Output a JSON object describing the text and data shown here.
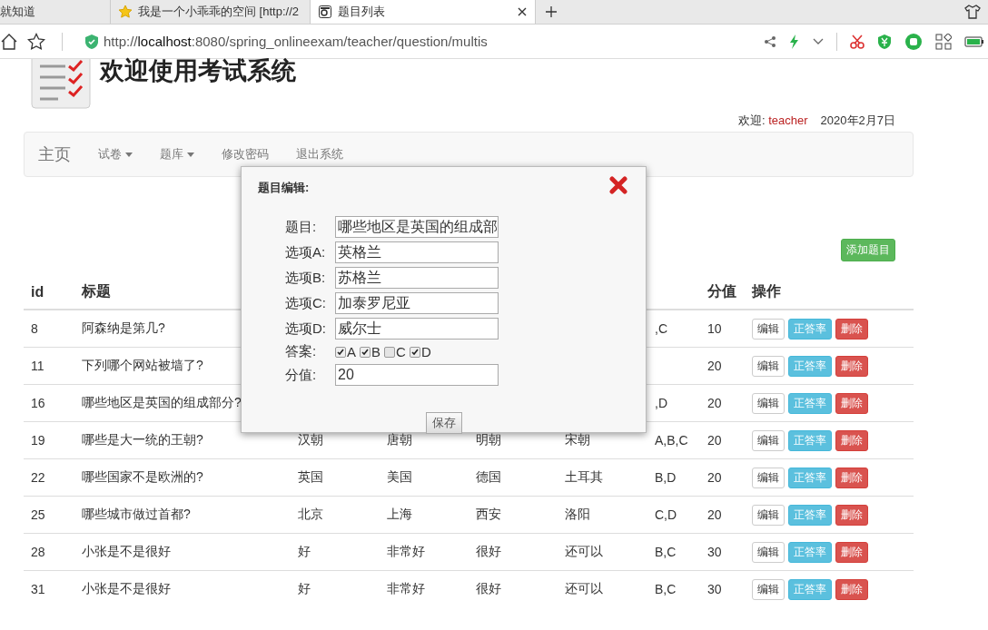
{
  "browser": {
    "tabs": [
      {
        "label": "就知道",
        "selected": false
      },
      {
        "label": "我是一个小乖乖的空间 [http://2",
        "selected": false
      },
      {
        "label": "题目列表",
        "selected": true
      }
    ],
    "address": {
      "scheme": "http://",
      "host": "localhost",
      "rest": ":8080/spring_onlineexam/teacher/question/multis"
    }
  },
  "header": {
    "title": "欢迎使用考试系统",
    "welcome_label": "欢迎:",
    "user": "teacher",
    "date": "2020年2月7日"
  },
  "nav": {
    "brand": "主页",
    "items": [
      {
        "label": "试卷",
        "dropdown": true
      },
      {
        "label": "题库",
        "dropdown": true
      },
      {
        "label": "修改密码",
        "dropdown": false
      },
      {
        "label": "退出系统",
        "dropdown": false
      }
    ]
  },
  "add_button": "添加题目",
  "table": {
    "columns": [
      {
        "label": "id"
      },
      {
        "label": "标题"
      },
      {},
      {},
      {},
      {},
      {},
      {
        "label": "分值"
      },
      {
        "label": "操作"
      }
    ],
    "rows": [
      {
        "id": "8",
        "title": "阿森纳是第几?",
        "answer": ",C",
        "score": "10"
      },
      {
        "id": "11",
        "title": "下列哪个网站被墙了?",
        "score": "20"
      },
      {
        "id": "16",
        "title": "哪些地区是英国的组成部分?",
        "answer": ",D",
        "score": "20"
      },
      {
        "id": "19",
        "title": "哪些是大一统的王朝?",
        "option_a": "汉朝",
        "option_b": "唐朝",
        "option_c": "明朝",
        "option_d": "宋朝",
        "answer": "A,B,C",
        "score": "20"
      },
      {
        "id": "22",
        "title": "哪些国家不是欧洲的?",
        "option_a": "英国",
        "option_b": "美国",
        "option_c": "德国",
        "option_d": "土耳其",
        "answer": "B,D",
        "score": "20"
      },
      {
        "id": "25",
        "title": "哪些城市做过首都?",
        "option_a": "北京",
        "option_b": "上海",
        "option_c": "西安",
        "option_d": "洛阳",
        "answer": "C,D",
        "score": "20"
      },
      {
        "id": "28",
        "title": "小张是不是很好",
        "option_a": "好",
        "option_b": "非常好",
        "option_c": "很好",
        "option_d": "还可以",
        "answer": "B,C",
        "score": "30"
      },
      {
        "id": "31",
        "title": "小张是不是很好",
        "option_a": "好",
        "option_b": "非常好",
        "option_c": "很好",
        "option_d": "还可以",
        "answer": "B,C",
        "score": "30"
      }
    ],
    "row_actions": [
      [
        {
          "label": "编辑",
          "kind": "default"
        },
        {
          "label": "正答率",
          "kind": "info"
        },
        {
          "label": "删除",
          "kind": "danger"
        }
      ],
      [
        {
          "label": "编辑",
          "kind": "default"
        },
        {
          "label": "正答率",
          "kind": "info"
        },
        {
          "label": "删除",
          "kind": "danger"
        }
      ],
      [
        {
          "label": "编辑",
          "kind": "default"
        },
        {
          "label": "正答率",
          "kind": "info"
        },
        {
          "label": "删除",
          "kind": "danger"
        }
      ],
      [
        {
          "label": "编辑",
          "kind": "default"
        },
        {
          "label": "正答率",
          "kind": "info"
        },
        {
          "label": "删除",
          "kind": "danger"
        }
      ],
      [
        {
          "label": "编辑",
          "kind": "default"
        },
        {
          "label": "正答率",
          "kind": "info"
        },
        {
          "label": "删除",
          "kind": "danger"
        }
      ],
      [
        {
          "label": "编辑",
          "kind": "default"
        },
        {
          "label": "正答率",
          "kind": "info"
        },
        {
          "label": "删除",
          "kind": "danger"
        }
      ],
      [
        {
          "label": "编辑",
          "kind": "default"
        },
        {
          "label": "正答率",
          "kind": "info"
        },
        {
          "label": "删除",
          "kind": "danger"
        }
      ],
      [
        {
          "label": "编辑",
          "kind": "default"
        },
        {
          "label": "正答率",
          "kind": "info"
        },
        {
          "label": "删除",
          "kind": "danger"
        }
      ]
    ]
  },
  "dialog": {
    "title": "题目编辑:",
    "fields": [
      {
        "label": "题目:",
        "value": "哪些地区是英国的组成部"
      },
      {
        "label": "选项A:",
        "value": "英格兰"
      },
      {
        "label": "选项B:",
        "value": "苏格兰"
      },
      {
        "label": "选项C:",
        "value": "加泰罗尼亚"
      },
      {
        "label": "选项D:",
        "value": "威尔士"
      }
    ],
    "answer": {
      "label": "答案:",
      "options": [
        {
          "label": "A",
          "checked": true
        },
        {
          "label": "B",
          "checked": true
        },
        {
          "label": "C",
          "checked": false
        },
        {
          "label": "D",
          "checked": true
        }
      ]
    },
    "score": {
      "label": "分值:",
      "value": "20"
    },
    "save": "保存"
  }
}
